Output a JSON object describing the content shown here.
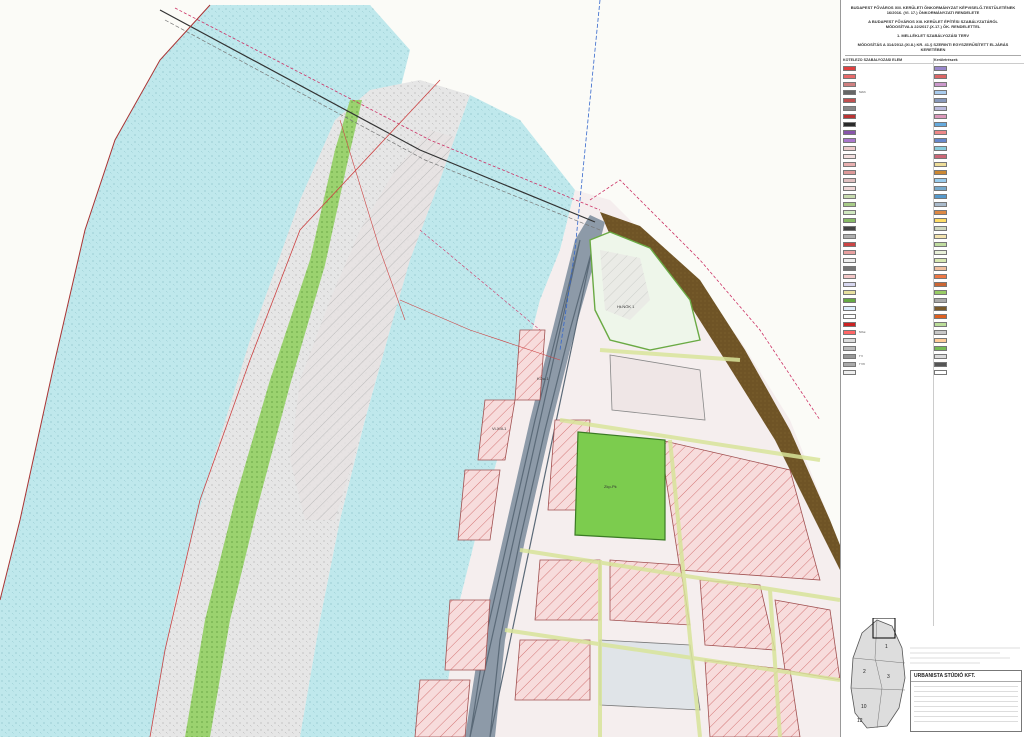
{
  "header": {
    "authority": "BUDAPEST FŐVÁROS XIII. KERÜLETI ÖNKORMÁNYZAT KÉPVISELŐ-TESTÜLETÉNEK",
    "decree_ref": "16/2016. (VI. 17.) ÖNKORMÁNYZATI RENDELETE",
    "subject": "A BUDAPEST FŐVÁROS XIII. KERÜLET ÉPÍTÉSI SZABÁLYZATÁRÓL",
    "modifies": "MÓDOSÍTVA A 22/2017.(X.17.) ÖK. RENDELETTEL",
    "annex": "1. MELLÉKLET SZABÁLYOZÁSI TERV",
    "procedure": "MÓDOSÍTÁS A 314/2012.(XI.8.) KR. 41.§ SZERINTI EGYSZERŰSÍTETT ELJÁRÁS KERETÉBEN"
  },
  "legend": {
    "left_title": "KÖTELEZŐ SZABÁLYOZÁSI ELEM",
    "right_title": "Kerületrészek",
    "left_items": [
      {
        "color": "#e04040",
        "label": ""
      },
      {
        "color": "#e86a6a",
        "label": ""
      },
      {
        "color": "#d08080",
        "label": ""
      },
      {
        "color": "#666666",
        "label": "MAX"
      },
      {
        "color": "#c05050",
        "label": ""
      },
      {
        "color": "#888888",
        "label": ""
      },
      {
        "color": "#bb3333",
        "label": ""
      },
      {
        "color": "#2a2a2a",
        "label": ""
      },
      {
        "color": "#8855aa",
        "label": ""
      },
      {
        "color": "#aa77cc",
        "label": ""
      },
      {
        "color": "#eecccc",
        "label": ""
      },
      {
        "color": "#f4e0e0",
        "label": ""
      },
      {
        "color": "#e8b0b0",
        "label": ""
      },
      {
        "color": "#dd9999",
        "label": ""
      },
      {
        "color": "#e0c0c0",
        "label": ""
      },
      {
        "color": "#f0d8d8",
        "label": ""
      },
      {
        "color": "#c8dcb0",
        "label": ""
      },
      {
        "color": "#a8cc88",
        "label": ""
      },
      {
        "color": "#d0e8c0",
        "label": ""
      },
      {
        "color": "#88bb66",
        "label": ""
      },
      {
        "color": "#444444",
        "label": ""
      },
      {
        "color": "#b0b0b0",
        "label": ""
      },
      {
        "color": "#cc4444",
        "label": ""
      },
      {
        "color": "#e8a0a0",
        "label": ""
      },
      {
        "color": "#f0f0f0",
        "label": ""
      },
      {
        "color": "#777777",
        "label": ""
      },
      {
        "color": "#f4c8c8",
        "label": ""
      },
      {
        "color": "#d8d8f0",
        "label": ""
      },
      {
        "color": "#e8e0a0",
        "label": ""
      },
      {
        "color": "#66aa44",
        "label": ""
      },
      {
        "color": "#e0f0ff",
        "label": ""
      },
      {
        "color": "#ffffff",
        "label": ""
      },
      {
        "color": "#cc2222",
        "label": ""
      },
      {
        "color": "#ff6666",
        "label": "MSZ"
      },
      {
        "color": "#dddddd",
        "label": ""
      },
      {
        "color": "#bbbbbb",
        "label": ""
      },
      {
        "color": "#999999",
        "label": "FV"
      },
      {
        "color": "#aaaaaa",
        "label": "FVK"
      },
      {
        "color": "#eeeeee",
        "label": ""
      }
    ],
    "right_items": [
      {
        "color": "#9988cc",
        "label": ""
      },
      {
        "color": "#dd6666",
        "label": ""
      },
      {
        "color": "#cc99cc",
        "label": ""
      },
      {
        "color": "#aaccee",
        "label": ""
      },
      {
        "color": "#8899bb",
        "label": ""
      },
      {
        "color": "#bbbbdd",
        "label": ""
      },
      {
        "color": "#dd99bb",
        "label": ""
      },
      {
        "color": "#66aadd",
        "label": ""
      },
      {
        "color": "#ee8888",
        "label": ""
      },
      {
        "color": "#6688cc",
        "label": ""
      },
      {
        "color": "#88ccdd",
        "label": ""
      },
      {
        "color": "#cc6677",
        "label": ""
      },
      {
        "color": "#eedd99",
        "label": ""
      },
      {
        "color": "#cc8833",
        "label": ""
      },
      {
        "color": "#99ccee",
        "label": ""
      },
      {
        "color": "#77aacc",
        "label": ""
      },
      {
        "color": "#5599cc",
        "label": ""
      },
      {
        "color": "#aabbcc",
        "label": ""
      },
      {
        "color": "#dd8844",
        "label": ""
      },
      {
        "color": "#ffdd66",
        "label": ""
      },
      {
        "color": "#cfd8c0",
        "label": ""
      },
      {
        "color": "#f4e4b0",
        "label": ""
      },
      {
        "color": "#c0dca0",
        "label": ""
      },
      {
        "color": "#e8f0d8",
        "label": ""
      },
      {
        "color": "#d8e8b0",
        "label": ""
      },
      {
        "color": "#f0c0a0",
        "label": ""
      },
      {
        "color": "#ee7744",
        "label": ""
      },
      {
        "color": "#cc6633",
        "label": ""
      },
      {
        "color": "#99cc66",
        "label": ""
      },
      {
        "color": "#aaaaaa",
        "label": ""
      },
      {
        "color": "#7a5a2a",
        "label": ""
      },
      {
        "color": "#e06020",
        "label": ""
      },
      {
        "color": "#bbdd99",
        "label": ""
      },
      {
        "color": "#c8c8c8",
        "label": ""
      },
      {
        "color": "#ffcc99",
        "label": ""
      },
      {
        "color": "#77bb55",
        "label": ""
      },
      {
        "color": "#dddddd",
        "label": ""
      },
      {
        "color": "#555555",
        "label": ""
      },
      {
        "color": "#ffffff",
        "label": ""
      }
    ]
  },
  "map_labels": {
    "park": "Zkp-Pk",
    "north_block": "Ht-NÖK 1",
    "road1": "KÖu-1",
    "block1": "Vi-XIII-1"
  },
  "key_map": {
    "n1": "1",
    "n2": "2",
    "n3": "3",
    "n10": "10",
    "n12": "12"
  },
  "title_block": {
    "company": "URBANISTA STÚDIÓ KFT."
  },
  "colors": {
    "water": "#bfe8ec",
    "floodplain": "#e8e8e8",
    "green_strip": "#7dbf55",
    "park_green": "#7ccc4e",
    "embankment_brown": "#6f5426",
    "road_gray": "#8d9aa8",
    "block_pink": "#f2d2d2",
    "hatch_red": "#cc4444"
  }
}
